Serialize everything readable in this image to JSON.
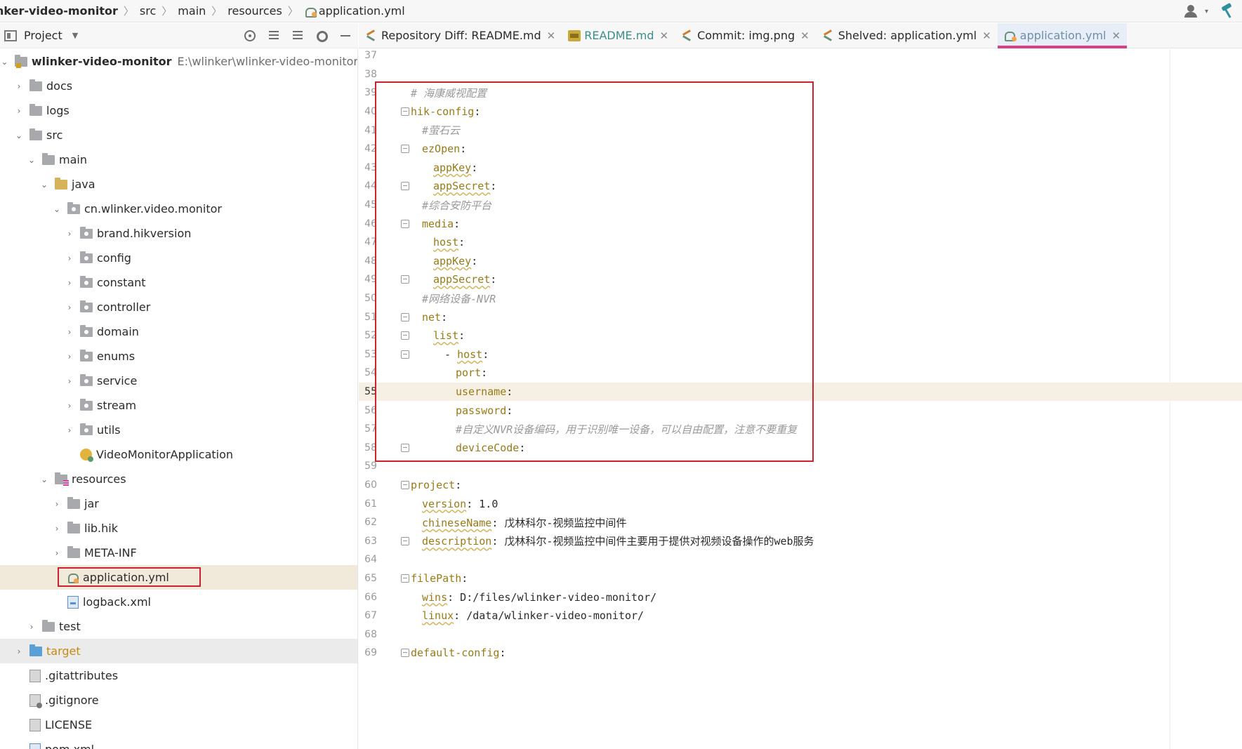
{
  "breadcrumb": {
    "items": [
      "wlinker-video-monitor",
      "src",
      "main",
      "resources",
      "application.yml"
    ],
    "project_visible": "nker-video-monitor"
  },
  "project_panel": {
    "title": "Project",
    "root_name": "wlinker-video-monitor",
    "root_path": "E:\\wlinker\\wlinker-video-monitor",
    "items": [
      {
        "label": "docs"
      },
      {
        "label": "logs"
      },
      {
        "label": "src"
      },
      {
        "label": "main"
      },
      {
        "label": "java"
      },
      {
        "label": "cn.wlinker.video.monitor"
      },
      {
        "label": "brand.hikversion"
      },
      {
        "label": "config"
      },
      {
        "label": "constant"
      },
      {
        "label": "controller"
      },
      {
        "label": "domain"
      },
      {
        "label": "enums"
      },
      {
        "label": "service"
      },
      {
        "label": "stream"
      },
      {
        "label": "utils"
      },
      {
        "label": "VideoMonitorApplication"
      },
      {
        "label": "resources"
      },
      {
        "label": "jar"
      },
      {
        "label": "lib.hik"
      },
      {
        "label": "META-INF"
      },
      {
        "label": "application.yml"
      },
      {
        "label": "logback.xml"
      },
      {
        "label": "test"
      },
      {
        "label": "target"
      },
      {
        "label": ".gitattributes"
      },
      {
        "label": ".gitignore"
      },
      {
        "label": "LICENSE"
      },
      {
        "label": "pom.xml"
      }
    ]
  },
  "tabs": [
    {
      "label": "Repository Diff: README.md",
      "icon": "diff-icon"
    },
    {
      "label": "README.md",
      "icon": "markdown-icon"
    },
    {
      "label": "Commit: img.png",
      "icon": "diff-icon"
    },
    {
      "label": "Shelved: application.yml",
      "icon": "diff-icon"
    },
    {
      "label": "application.yml",
      "icon": "yaml-icon",
      "active": true
    }
  ],
  "editor": {
    "current_line": 55,
    "lines": [
      {
        "n": "37",
        "key": "",
        "val": "",
        "comment": ""
      },
      {
        "n": "38",
        "key": "",
        "val": "",
        "comment": ""
      },
      {
        "n": "39",
        "key": "",
        "val": "",
        "comment": "# 海康威视配置"
      },
      {
        "n": "40",
        "key": "hik-config",
        "val": "",
        "comment": ""
      },
      {
        "n": "41",
        "key": "",
        "val": "",
        "comment": "#萤石云"
      },
      {
        "n": "42",
        "key": "ezOpen",
        "val": "",
        "comment": ""
      },
      {
        "n": "43",
        "key": "appKey",
        "val": "",
        "comment": ""
      },
      {
        "n": "44",
        "key": "appSecret",
        "val": "",
        "comment": ""
      },
      {
        "n": "45",
        "key": "",
        "val": "",
        "comment": "#综合安防平台"
      },
      {
        "n": "46",
        "key": "media",
        "val": "",
        "comment": ""
      },
      {
        "n": "47",
        "key": "host",
        "val": "",
        "comment": ""
      },
      {
        "n": "48",
        "key": "appKey",
        "val": "",
        "comment": ""
      },
      {
        "n": "49",
        "key": "appSecret",
        "val": "",
        "comment": ""
      },
      {
        "n": "50",
        "key": "",
        "val": "",
        "comment": "#网络设备-NVR"
      },
      {
        "n": "51",
        "key": "net",
        "val": "",
        "comment": ""
      },
      {
        "n": "52",
        "key": "list",
        "val": "",
        "comment": ""
      },
      {
        "n": "53",
        "key": "host",
        "val": "",
        "comment": "",
        "dash": "- "
      },
      {
        "n": "54",
        "key": "port",
        "val": "",
        "comment": ""
      },
      {
        "n": "55",
        "key": "username",
        "val": "",
        "comment": ""
      },
      {
        "n": "56",
        "key": "password",
        "val": "",
        "comment": ""
      },
      {
        "n": "57",
        "key": "",
        "val": "",
        "comment": "#自定义NVR设备编码，用于识别唯一设备，可以自由配置，注意不要重复"
      },
      {
        "n": "58",
        "key": "deviceCode",
        "val": "",
        "comment": ""
      },
      {
        "n": "59",
        "key": "",
        "val": "",
        "comment": ""
      },
      {
        "n": "60",
        "key": "project",
        "val": "",
        "comment": ""
      },
      {
        "n": "61",
        "key": "version",
        "val": "1.0",
        "comment": ""
      },
      {
        "n": "62",
        "key": "chineseName",
        "val": "戊林科尔-视频监控中间件",
        "comment": ""
      },
      {
        "n": "63",
        "key": "description",
        "val": "戊林科尔-视频监控中间件主要用于提供对视频设备操作的web服务",
        "comment": ""
      },
      {
        "n": "64",
        "key": "",
        "val": "",
        "comment": ""
      },
      {
        "n": "65",
        "key": "filePath",
        "val": "",
        "comment": ""
      },
      {
        "n": "66",
        "key": "wins",
        "val": "D:/files/wlinker-video-monitor/",
        "comment": ""
      },
      {
        "n": "67",
        "key": "linux",
        "val": "/data/wlinker-video-monitor/",
        "comment": ""
      },
      {
        "n": "68",
        "key": "",
        "val": "",
        "comment": ""
      },
      {
        "n": "69",
        "key": "default-config",
        "val": "",
        "comment": ""
      }
    ]
  },
  "colors": {
    "accent_tab_underline": "#d83f87",
    "annotation_red": "#d0222e",
    "yaml_key": "#9b7a16",
    "comment": "#9a9a9a"
  }
}
